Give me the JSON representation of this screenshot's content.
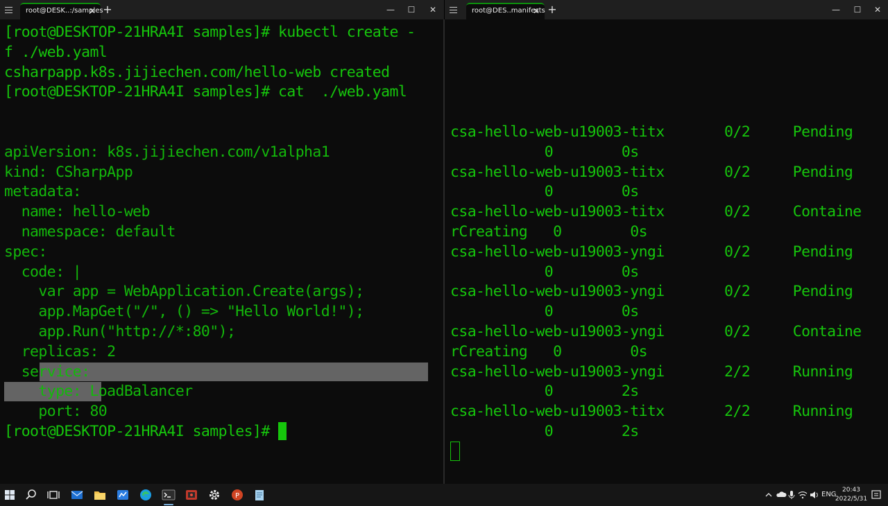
{
  "left_window": {
    "tab_title": "root@DESK..:/samples",
    "tab_close": "✕",
    "new_tab": "+",
    "controls": {
      "minimize": "—",
      "maximize": "☐",
      "close": "✕"
    },
    "lines": [
      "[root@DESKTOP-21HRA4I samples]# kubectl create -",
      "f ./web.yaml",
      "csharpapp.k8s.jijiechen.com/hello-web created",
      "[root@DESKTOP-21HRA4I samples]# cat  ./web.yaml",
      "",
      "",
      "apiVersion: k8s.jijiechen.com/v1alpha1",
      "kind: CSharpApp",
      "metadata:",
      "  name: hello-web",
      "  namespace: default",
      "spec:",
      "  code: |",
      "    var app = WebApplication.Create(args);",
      "    app.MapGet(\"/\", () => \"Hello World!\");",
      "    app.Run(\"http://*:80\");",
      "  replicas: 2",
      "  service:",
      "    type: LoadBalancer",
      "    port: 80"
    ],
    "prompt": "[root@DESKTOP-21HRA4I samples]# "
  },
  "right_window": {
    "tab_title": "root@DES..manifests",
    "tab_close": "✕",
    "new_tab": "+",
    "controls": {
      "minimize": "—",
      "maximize": "☐",
      "close": "✕"
    },
    "lines": [
      "csa-hello-web-u19003-titx       0/2     Pending",
      "           0        0s",
      "csa-hello-web-u19003-titx       0/2     Pending",
      "           0        0s",
      "csa-hello-web-u19003-titx       0/2     Containe",
      "rCreating   0        0s",
      "csa-hello-web-u19003-yngi       0/2     Pending",
      "           0        0s",
      "csa-hello-web-u19003-yngi       0/2     Pending",
      "           0        0s",
      "csa-hello-web-u19003-yngi       0/2     Containe",
      "rCreating   0        0s",
      "csa-hello-web-u19003-yngi       2/2     Running",
      "           0        2s",
      "csa-hello-web-u19003-titx       2/2     Running",
      "           0        2s"
    ]
  },
  "taskbar": {
    "language": "ENG",
    "time": "20:43",
    "date": "2022/5/31"
  },
  "colors": {
    "terminal_green": "#16c60c",
    "terminal_bg": "#0c0c0c",
    "tab_accent": "#0c8f0c",
    "taskbar_bg": "#161616"
  }
}
